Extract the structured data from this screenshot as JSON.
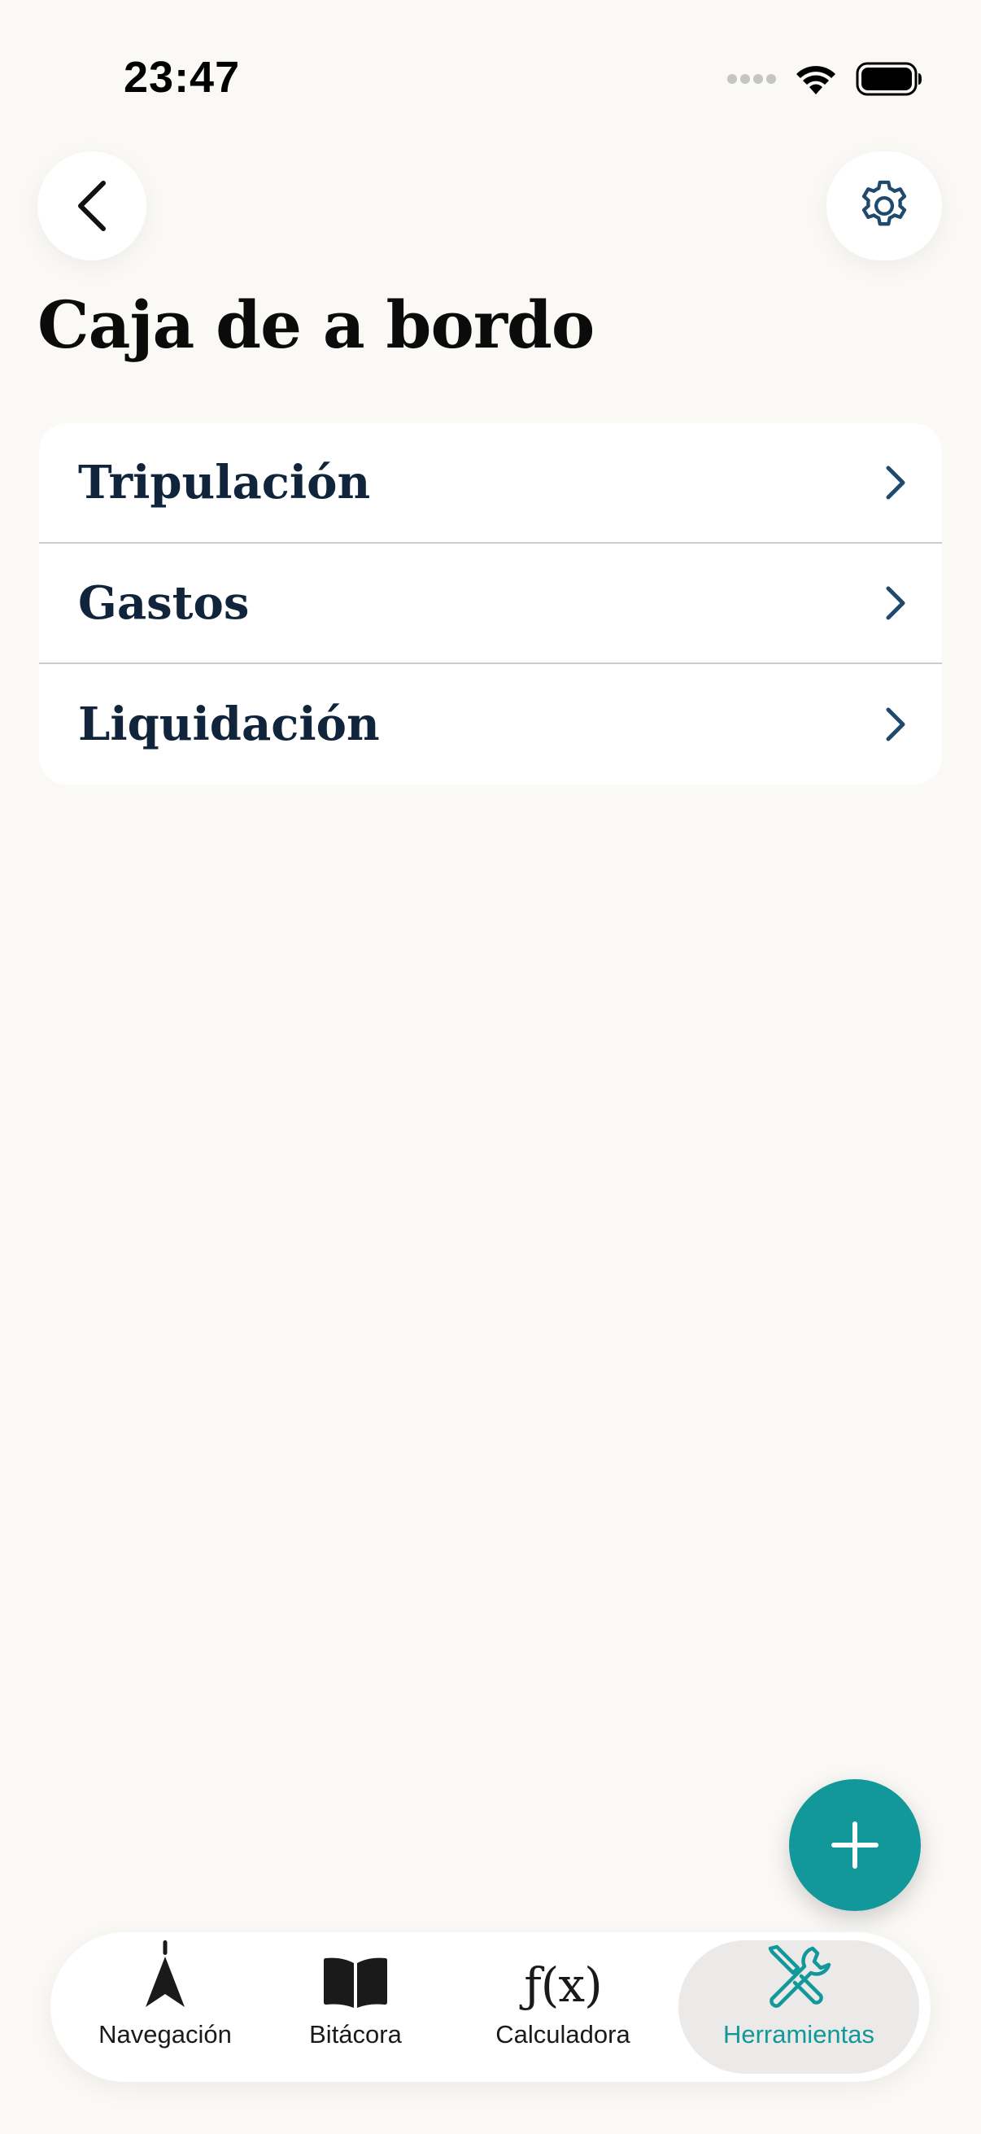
{
  "status_bar": {
    "time": "23:47",
    "icons": [
      "cellular-dots-icon",
      "wifi-icon",
      "battery-icon"
    ]
  },
  "header": {
    "back_icon": "chevron-left-icon",
    "settings_icon": "gear-icon",
    "title": "Caja de a bordo"
  },
  "menu": {
    "items": [
      {
        "label": "Tripulación"
      },
      {
        "label": "Gastos"
      },
      {
        "label": "Liquidación"
      }
    ],
    "chevron_icon": "chevron-right-icon"
  },
  "fab": {
    "icon": "plus-icon"
  },
  "tab_bar": {
    "tabs": [
      {
        "label": "Navegación",
        "icon": "navigation-arrow-icon",
        "active": false
      },
      {
        "label": "Bitácora",
        "icon": "book-icon",
        "active": false
      },
      {
        "label": "Calculadora",
        "icon": "function-icon",
        "glyph": "ƒ(x)",
        "active": false
      },
      {
        "label": "Herramientas",
        "icon": "tools-icon",
        "active": true
      }
    ]
  },
  "colors": {
    "background": "#FAF9F6",
    "accent": "#12989A",
    "title_text": "#10243B",
    "icon_blue": "#1F4A6E"
  }
}
